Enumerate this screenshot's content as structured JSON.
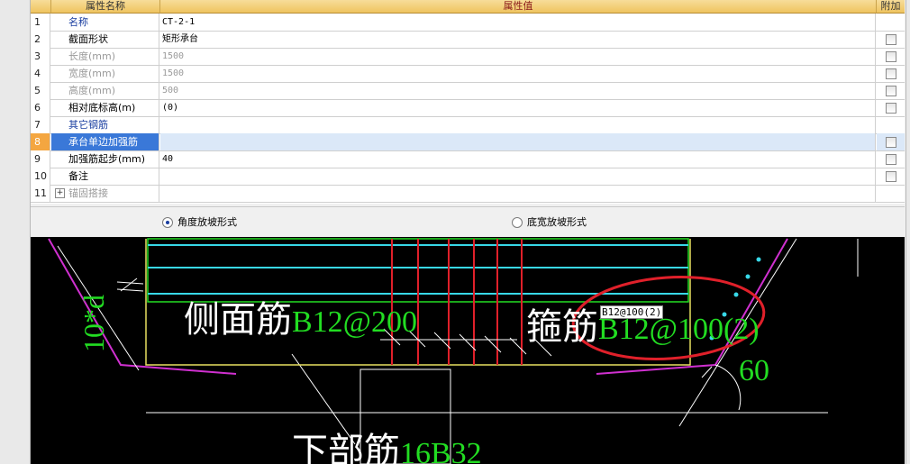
{
  "grid": {
    "header_name": "属性名称",
    "header_value": "属性值",
    "header_add": "附加",
    "rows": [
      {
        "num": "1",
        "name": "名称",
        "value": "CT-2-1",
        "style": "blue",
        "cb": false
      },
      {
        "num": "2",
        "name": "截面形状",
        "value": "矩形承台",
        "style": "normal",
        "cb": true
      },
      {
        "num": "3",
        "name": "长度(mm)",
        "value": "1500",
        "style": "grey",
        "cb": true
      },
      {
        "num": "4",
        "name": "宽度(mm)",
        "value": "1500",
        "style": "grey",
        "cb": true
      },
      {
        "num": "5",
        "name": "高度(mm)",
        "value": "500",
        "style": "grey",
        "cb": true
      },
      {
        "num": "6",
        "name": "相对底标高(m)",
        "value": "(0)",
        "style": "normal",
        "cb": true
      },
      {
        "num": "7",
        "name": "其它钢筋",
        "value": "",
        "style": "blue",
        "cb": false
      },
      {
        "num": "8",
        "name": "承台单边加强筋",
        "value": "",
        "style": "selected",
        "cb": true
      },
      {
        "num": "9",
        "name": "加强筋起步(mm)",
        "value": "40",
        "style": "normal",
        "cb": true
      },
      {
        "num": "10",
        "name": "备注",
        "value": "",
        "style": "normal",
        "cb": true
      },
      {
        "num": "11",
        "name": "锚固搭接",
        "value": "",
        "style": "grey",
        "cb": false
      }
    ]
  },
  "options": {
    "angle_label": "角度放坡形式",
    "bottom_label": "底宽放坡形式",
    "selected": "angle"
  },
  "drawing": {
    "side_label": "侧面筋",
    "side_value": "B12@200",
    "stirrup_label": "箍筋",
    "stirrup_value": "B12@100(2)",
    "tooltip": "B12@100(2)",
    "bottom_label": "下部筋",
    "bottom_value": "16B32",
    "angle": "60",
    "vertical_text": "10*d"
  },
  "colors": {
    "green_text": "#22dd22",
    "white_text": "#ffffff",
    "red_annotation": "#e0202a",
    "cyan": "#38d8e8",
    "magenta": "#d030d0",
    "yellow": "#e8e060"
  }
}
